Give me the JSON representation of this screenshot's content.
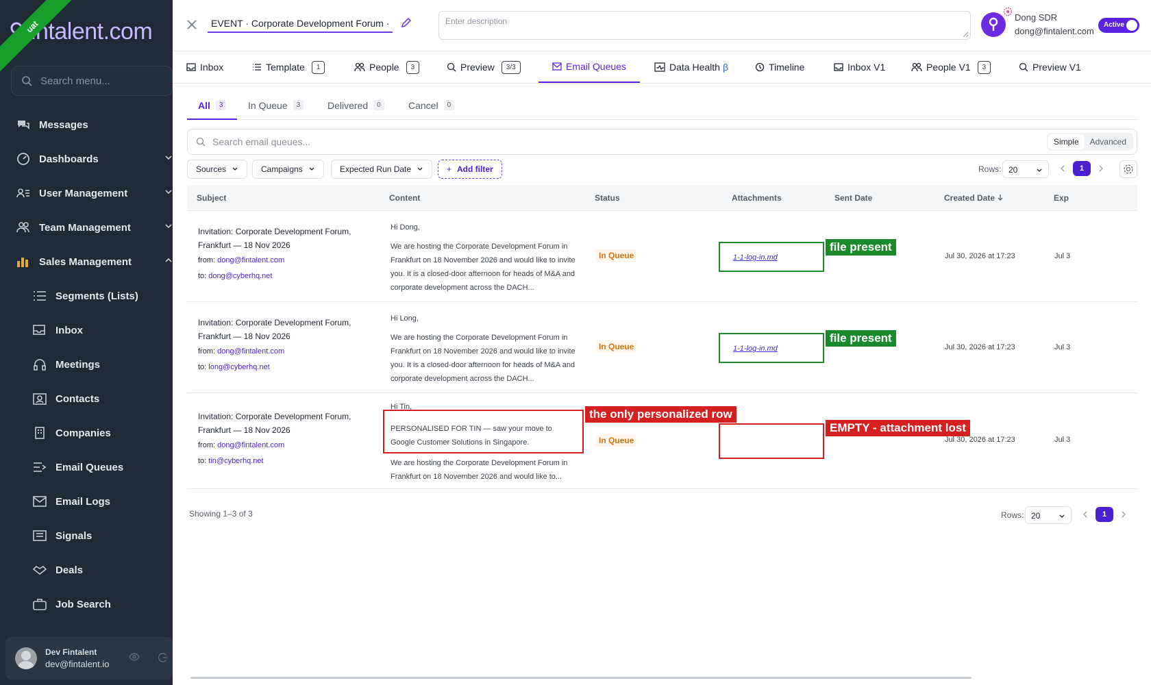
{
  "sidebar": {
    "logo_text": "fintalent.com",
    "env_ribbon": "uat",
    "search_placeholder": "Search menu...",
    "items": [
      {
        "label": "Messages",
        "icon": "messages-icon"
      },
      {
        "label": "Dashboards",
        "icon": "dashboard-icon"
      },
      {
        "label": "User Management",
        "icon": "user-list-icon"
      },
      {
        "label": "Team Management",
        "icon": "team-icon"
      },
      {
        "label": "Sales Management",
        "icon": "bar-chart-icon"
      },
      {
        "label": "Segments (Lists)",
        "icon": "list-icon"
      },
      {
        "label": "Inbox",
        "icon": "inbox-icon"
      },
      {
        "label": "Meetings",
        "icon": "headset-icon"
      },
      {
        "label": "Contacts",
        "icon": "contacts-icon"
      },
      {
        "label": "Companies",
        "icon": "building-icon"
      },
      {
        "label": "Email Queues",
        "icon": "queue-icon"
      },
      {
        "label": "Email Logs",
        "icon": "mail-icon"
      },
      {
        "label": "Signals",
        "icon": "signals-icon"
      },
      {
        "label": "Deals",
        "icon": "handshake-icon"
      },
      {
        "label": "Job Search",
        "icon": "briefcase-icon"
      }
    ],
    "user": {
      "name": "Dev Fintalent",
      "email": "dev@fintalent.io"
    }
  },
  "header": {
    "event_title": "EVENT · Corporate Development Forum · F",
    "description_placeholder": "Enter description",
    "user_name": "Dong SDR",
    "user_email": "dong@fintalent.com",
    "status_toggle": "Active"
  },
  "tabs": [
    {
      "label": "Inbox",
      "count": ""
    },
    {
      "label": "Template",
      "count": "1"
    },
    {
      "label": "People",
      "count": "3"
    },
    {
      "label": "Preview",
      "count": "3/3"
    },
    {
      "label": "Email Queues",
      "count": "",
      "active": true
    },
    {
      "label": "Data Health",
      "count": "",
      "suffix": "β"
    },
    {
      "label": "Timeline",
      "count": ""
    },
    {
      "label": "Inbox V1",
      "count": ""
    },
    {
      "label": "People V1",
      "count": "3"
    },
    {
      "label": "Preview V1",
      "count": ""
    }
  ],
  "subtabs": [
    {
      "label": "All",
      "count": "3"
    },
    {
      "label": "In Queue",
      "count": "3"
    },
    {
      "label": "Delivered",
      "count": "0"
    },
    {
      "label": "Cancel",
      "count": "0"
    }
  ],
  "search": {
    "placeholder": "Search email queues...",
    "mode_simple": "Simple",
    "mode_advanced": "Advanced"
  },
  "filters": {
    "sources": "Sources",
    "campaigns": "Campaigns",
    "run_date": "Expected Run Date",
    "add": "Add filter"
  },
  "pagination": {
    "rows_label": "Rows:",
    "rows_value": "20",
    "page": "1"
  },
  "table": {
    "headers": [
      "Subject",
      "Content",
      "Status",
      "Attachments",
      "Sent Date",
      "Created Date",
      "Exp"
    ],
    "rows": [
      {
        "subject_line1": "Invitation: Corporate Development Forum,",
        "subject_line2": "Frankfurt — 18 Nov 2026",
        "from_label": "from:",
        "from": "dong@fintalent.com",
        "to_label": "to:",
        "to": "dong@cyberhq.net",
        "greeting": "Hi Dong,",
        "body": "We are hosting the Corporate Development Forum in Frankfurt on 18 November 2026 and would like to invite you. It is a closed-door afternoon for heads of M&A and corporate development across the DACH...",
        "status": "In Queue",
        "attachment": "1-1-log-in.md",
        "created": "Jul 30, 2026 at 17:23",
        "exp": "Jul 3"
      },
      {
        "subject_line1": "Invitation: Corporate Development Forum,",
        "subject_line2": "Frankfurt — 18 Nov 2026",
        "from_label": "from:",
        "from": "dong@fintalent.com",
        "to_label": "to:",
        "to": "long@cyberhq.net",
        "greeting": "Hi Long,",
        "body": "We are hosting the Corporate Development Forum in Frankfurt on 18 November 2026 and would like to invite you. It is a closed-door afternoon for heads of M&A and corporate development across the DACH...",
        "status": "In Queue",
        "attachment": "1-1-log-in.md",
        "created": "Jul 30, 2026 at 17:23",
        "exp": "Jul 3"
      },
      {
        "subject_line1": "Invitation: Corporate Development Forum,",
        "subject_line2": "Frankfurt — 18 Nov 2026",
        "from_label": "from:",
        "from": "dong@fintalent.com",
        "to_label": "to:",
        "to": "tin@cyberhq.net",
        "greeting": "Hi Tin,",
        "personal": "PERSONALISED FOR TIN — saw your move to Google Customer Solutions in Singapore.",
        "body": "We are hosting the Corporate Development Forum in Frankfurt on 18 November 2026 and would like to...",
        "status": "In Queue",
        "attachment": "",
        "created": "Jul 30, 2026 at 17:23",
        "exp": "Jul 3"
      }
    ]
  },
  "annotations": {
    "file_present": "file present",
    "personalized": "the only personalized row",
    "empty": "EMPTY - attachment lost"
  },
  "footer": {
    "showing": "Showing 1–3 of 3"
  },
  "colors": {
    "accent": "#5b21e0",
    "sidebar_bg": "#1f2a36",
    "status_queue": "#d9730d",
    "annotation_green": "#1a8a2c",
    "annotation_red": "#d42020"
  }
}
